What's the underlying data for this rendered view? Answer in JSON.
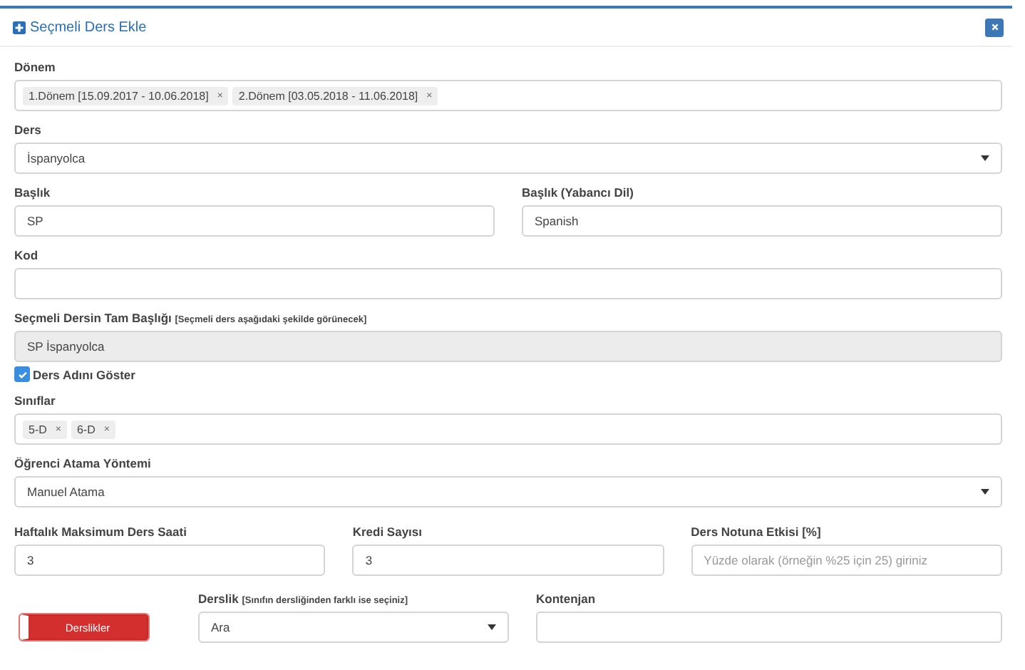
{
  "panel": {
    "title": "Seçmeli Ders Ekle"
  },
  "donem": {
    "label": "Dönem",
    "tags": [
      {
        "text": "1.Dönem [15.09.2017 - 10.06.2018]",
        "remove": "×"
      },
      {
        "text": "2.Dönem [03.05.2018 - 11.06.2018]",
        "remove": "×"
      }
    ]
  },
  "ders": {
    "label": "Ders",
    "value": "İspanyolca"
  },
  "baslik": {
    "label": "Başlık",
    "value": "SP"
  },
  "baslik_yabanci": {
    "label": "Başlık (Yabancı Dil)",
    "value": "Spanish"
  },
  "kod": {
    "label": "Kod"
  },
  "tam_baslik": {
    "label": "Seçmeli Dersin Tam Başlığı",
    "hint": "[Seçmeli ders aşağıdaki şekilde görünecek]",
    "value": "SP İspanyolca"
  },
  "ders_adi_goster": {
    "label": "Ders Adını Göster",
    "checked": true
  },
  "siniflar": {
    "label": "Sınıflar",
    "tags": [
      {
        "text": "5-D",
        "remove": "×"
      },
      {
        "text": "6-D",
        "remove": "×"
      }
    ]
  },
  "atama": {
    "label": "Öğrenci Atama Yöntemi",
    "value": "Manuel Atama"
  },
  "haftalik": {
    "label": "Haftalık Maksimum Ders Saati",
    "value": "3"
  },
  "kredi": {
    "label": "Kredi Sayısı",
    "value": "3"
  },
  "etki": {
    "label": "Ders Notuna Etkisi [%]",
    "placeholder": "Yüzde olarak (örneğin %25 için 25) giriniz"
  },
  "derslikler": {
    "label": "Derslikler",
    "on": false
  },
  "derslik": {
    "label": "Derslik",
    "hint": "[Sınıfın dersliğinden farklı ise seçiniz]",
    "value": "Ara"
  },
  "kontenjan": {
    "label": "Kontenjan"
  }
}
